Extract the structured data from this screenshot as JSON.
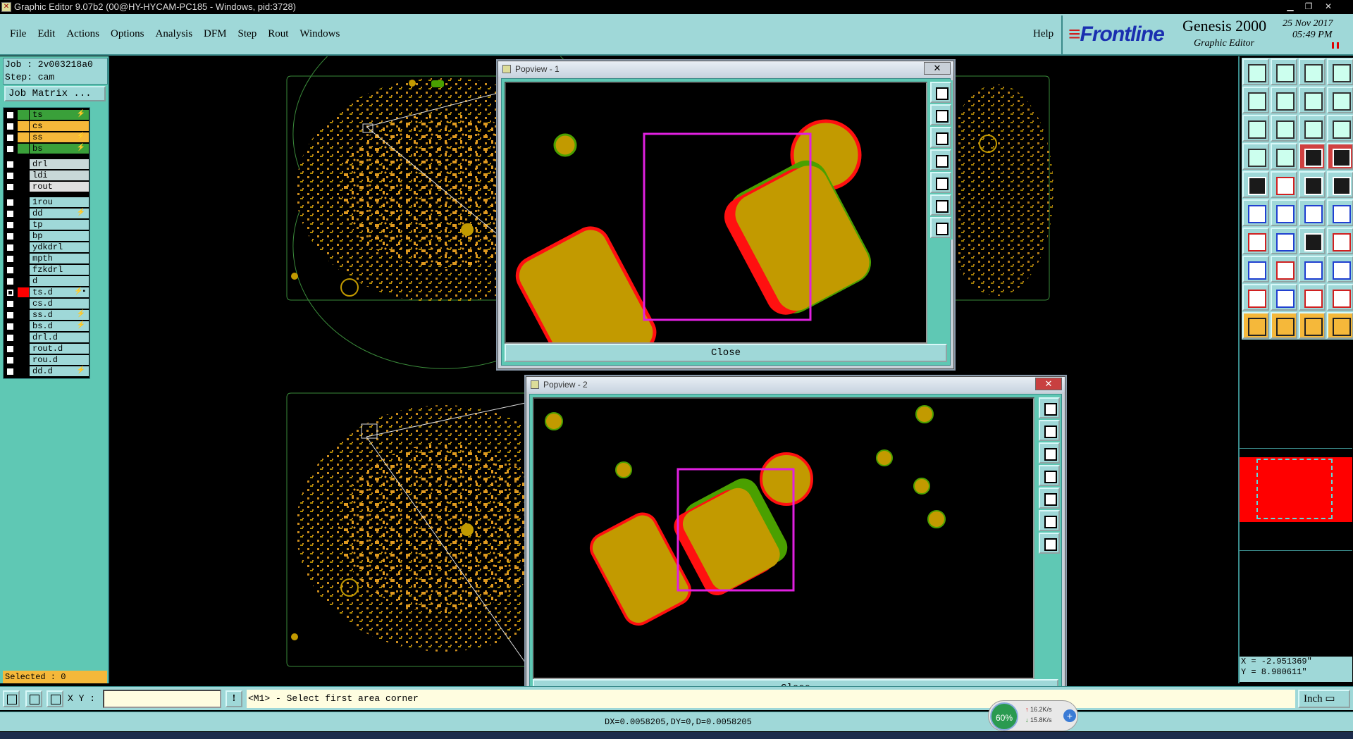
{
  "titlebar": {
    "title": "Graphic Editor 9.07b2 (00@HY-HYCAM-PC185 - Windows, pid:3728)",
    "minimize": "▁",
    "restore": "❐",
    "close": "✕"
  },
  "menubar": {
    "items": [
      "File",
      "Edit",
      "Actions",
      "Options",
      "Analysis",
      "DFM",
      "Step",
      "Rout",
      "Windows"
    ],
    "help": "Help"
  },
  "brand": {
    "logo": "Frontline",
    "product": "Genesis 2000",
    "subtitle": "Graphic Editor",
    "date": "25 Nov 2017",
    "time": "05:49 PM"
  },
  "job": {
    "job_line": "Job : 2v003218a0",
    "step_line": "Step: cam",
    "matrix_button": "Job Matrix ..."
  },
  "layers": [
    {
      "name": "ts",
      "swatch": "#3aa03a",
      "name_bg": "#3aa03a",
      "mark": "⚡",
      "checked": false
    },
    {
      "name": "cs",
      "swatch": "#f5b83a",
      "name_bg": "#f5b83a",
      "mark": "",
      "checked": false
    },
    {
      "name": "ss",
      "swatch": "#f5b83a",
      "name_bg": "#f5b83a",
      "mark": "⚡",
      "checked": false
    },
    {
      "name": "bs",
      "swatch": "#3aa03a",
      "name_bg": "#3aa03a",
      "mark": "⚡",
      "checked": false
    },
    {
      "gap": true
    },
    {
      "name": "drl",
      "swatch": "#000000",
      "name_bg": "#c8d8d8",
      "mark": "",
      "checked": false
    },
    {
      "name": "ldi",
      "swatch": "#000000",
      "name_bg": "#c8d8d8",
      "mark": "",
      "checked": false
    },
    {
      "name": "rout",
      "swatch": "#000000",
      "name_bg": "#e0e0e0",
      "mark": "",
      "checked": false
    },
    {
      "gap": true
    },
    {
      "name": "1rou",
      "swatch": "#000000",
      "name_bg": "#9fd8d8",
      "mark": "",
      "checked": false
    },
    {
      "name": "dd",
      "swatch": "#000000",
      "name_bg": "#9fd8d8",
      "mark": "⚡",
      "checked": false
    },
    {
      "name": "tp",
      "swatch": "#000000",
      "name_bg": "#9fd8d8",
      "mark": "",
      "checked": false
    },
    {
      "name": "bp",
      "swatch": "#000000",
      "name_bg": "#9fd8d8",
      "mark": "",
      "checked": false
    },
    {
      "name": "ydkdrl",
      "swatch": "#000000",
      "name_bg": "#9fd8d8",
      "mark": "",
      "checked": false
    },
    {
      "name": "mpth",
      "swatch": "#000000",
      "name_bg": "#9fd8d8",
      "mark": "",
      "checked": false
    },
    {
      "name": "fzkdrl",
      "swatch": "#000000",
      "name_bg": "#9fd8d8",
      "mark": "",
      "checked": false
    },
    {
      "name": "d",
      "swatch": "#000000",
      "name_bg": "#9fd8d8",
      "mark": "",
      "checked": false
    },
    {
      "name": "ts.d",
      "swatch": "#ff0000",
      "name_bg": "#9fd8d8",
      "mark": "⚡▪",
      "checked": true
    },
    {
      "name": "cs.d",
      "swatch": "#000000",
      "name_bg": "#9fd8d8",
      "mark": "",
      "checked": false
    },
    {
      "name": "ss.d",
      "swatch": "#000000",
      "name_bg": "#9fd8d8",
      "mark": "⚡",
      "checked": false
    },
    {
      "name": "bs.d",
      "swatch": "#000000",
      "name_bg": "#9fd8d8",
      "mark": "⚡",
      "checked": false
    },
    {
      "name": "drl.d",
      "swatch": "#000000",
      "name_bg": "#9fd8d8",
      "mark": "",
      "checked": false
    },
    {
      "name": "rout.d",
      "swatch": "#000000",
      "name_bg": "#9fd8d8",
      "mark": "",
      "checked": false
    },
    {
      "name": "rou.d",
      "swatch": "#000000",
      "name_bg": "#9fd8d8",
      "mark": "",
      "checked": false
    },
    {
      "name": "dd.d",
      "swatch": "#000000",
      "name_bg": "#9fd8d8",
      "mark": "⚡",
      "checked": false
    }
  ],
  "selected_text": "Selected : 0",
  "popview1": {
    "title": "Popview - 1",
    "close_button": "Close",
    "close_x": "✕"
  },
  "popview2": {
    "title": "Popview - 2",
    "close_button": "Close",
    "close_x": "✕"
  },
  "bottombar": {
    "xy_label": "X Y :",
    "xy_value": "",
    "excl": "!",
    "prompt": "<M1> - Select first area corner",
    "unit": "Inch"
  },
  "coords": {
    "x": "X = -2.951369\"",
    "y": "Y = 8.980611\""
  },
  "status_text": "DX=0.0058205,DY=0,D=0.0058205",
  "network": {
    "percent": "60%",
    "up": "16.2K/s",
    "down": "15.8K/s",
    "plus": "+"
  },
  "colors": {
    "panel": "#9fd8d8",
    "panel_dark": "#5fc8b4",
    "pad": "#c29a00",
    "outline_red": "#ff1010",
    "outline_green": "#4aa000",
    "selection": "#e020e0"
  }
}
